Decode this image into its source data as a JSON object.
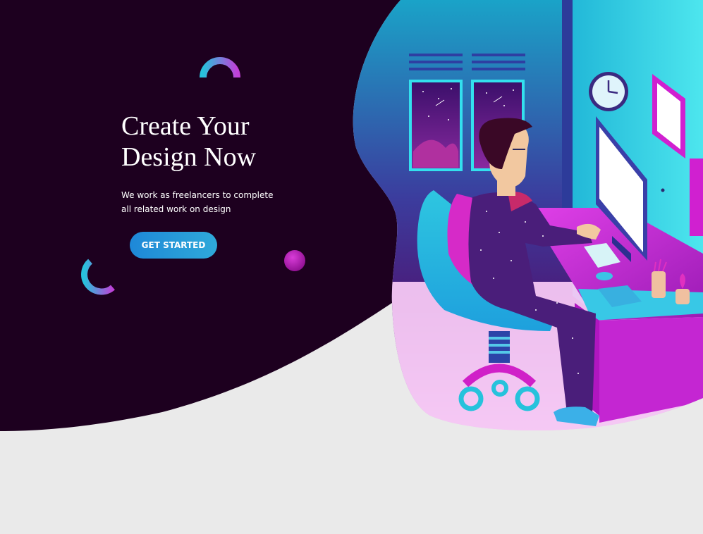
{
  "hero": {
    "title_line1": "Create Your",
    "title_line2": "Design Now",
    "subtitle_line1": "We work as freelancers to complete",
    "subtitle_line2": "all related work on design",
    "cta_label": "GET STARTED"
  },
  "colors": {
    "background": "#eaeaea",
    "hero_dark": "#1d001f",
    "cta_start": "#1e88d8",
    "cta_end": "#2fa9d9",
    "accent_cyan": "#14c9d9",
    "accent_magenta": "#c020c0",
    "accent_purple": "#4a1e7a"
  },
  "illustration": {
    "clock_icon": "clock-icon",
    "monitor_icon": "monitor-icon",
    "chair_icon": "chair-icon",
    "person_icon": "person-illustration"
  }
}
